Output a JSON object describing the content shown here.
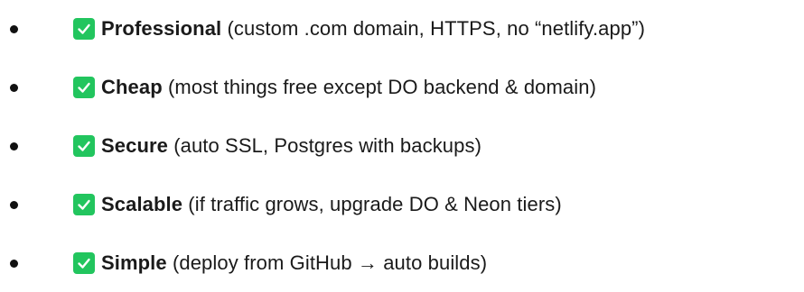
{
  "items": [
    {
      "title": "Professional",
      "detail": " (custom .com domain, HTTPS, no “netlify.app”)",
      "icon": "checkmark-icon"
    },
    {
      "title": "Cheap",
      "detail": " (most things free except DO backend & domain)",
      "icon": "checkmark-icon"
    },
    {
      "title": "Secure",
      "detail": " (auto SSL, Postgres with backups)",
      "icon": "checkmark-icon"
    },
    {
      "title": "Scalable",
      "detail": " (if traffic grows, upgrade DO & Neon tiers)",
      "icon": "checkmark-icon"
    },
    {
      "title": "Simple",
      "detail": " (deploy from GitHub → auto builds)",
      "icon": "checkmark-icon"
    }
  ],
  "colors": {
    "check_background": "#22c55e",
    "check_mark": "#ffffff",
    "text": "#1a1a1a"
  }
}
